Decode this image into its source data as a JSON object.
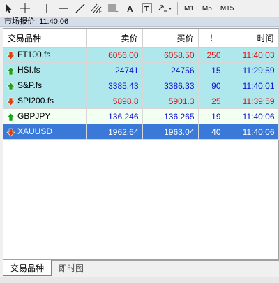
{
  "toolbar": {
    "timeframes": [
      "M1",
      "M5",
      "M15"
    ]
  },
  "window": {
    "title": "市场报价: 11:40:06"
  },
  "table": {
    "headers": [
      "交易品种",
      "卖价",
      "买价",
      "!",
      "时间"
    ],
    "rows": [
      {
        "symbol": "FT100.fs",
        "bid": "6056.00",
        "ask": "6058.50",
        "spread": "250",
        "time": "11:40:03",
        "dir": "down",
        "color": "red",
        "style": "cyan"
      },
      {
        "symbol": "HSI.fs",
        "bid": "24741",
        "ask": "24756",
        "spread": "15",
        "time": "11:29:59",
        "dir": "up",
        "color": "blue",
        "style": "cyan"
      },
      {
        "symbol": "S&P.fs",
        "bid": "3385.43",
        "ask": "3386.33",
        "spread": "90",
        "time": "11:40:01",
        "dir": "up",
        "color": "blue",
        "style": "cyan"
      },
      {
        "symbol": "SPI200.fs",
        "bid": "5898.8",
        "ask": "5901.3",
        "spread": "25",
        "time": "11:39:59",
        "dir": "down",
        "color": "red",
        "style": "cyan"
      },
      {
        "symbol": "GBPJPY",
        "bid": "136.246",
        "ask": "136.265",
        "spread": "19",
        "time": "11:40:06",
        "dir": "up",
        "color": "blue",
        "style": "white"
      },
      {
        "symbol": "XAUUSD",
        "bid": "1962.64",
        "ask": "1963.04",
        "spread": "40",
        "time": "11:40:06",
        "dir": "down",
        "color": "white",
        "style": "sel"
      }
    ]
  },
  "tabs": [
    {
      "label": "交易品种",
      "active": true
    },
    {
      "label": "即时图",
      "active": false
    }
  ],
  "colors": {
    "down_arrow": "#e04010",
    "up_arrow": "#20a020",
    "selected_row": "#3a79d8",
    "cyan_row": "#aee8ec"
  }
}
